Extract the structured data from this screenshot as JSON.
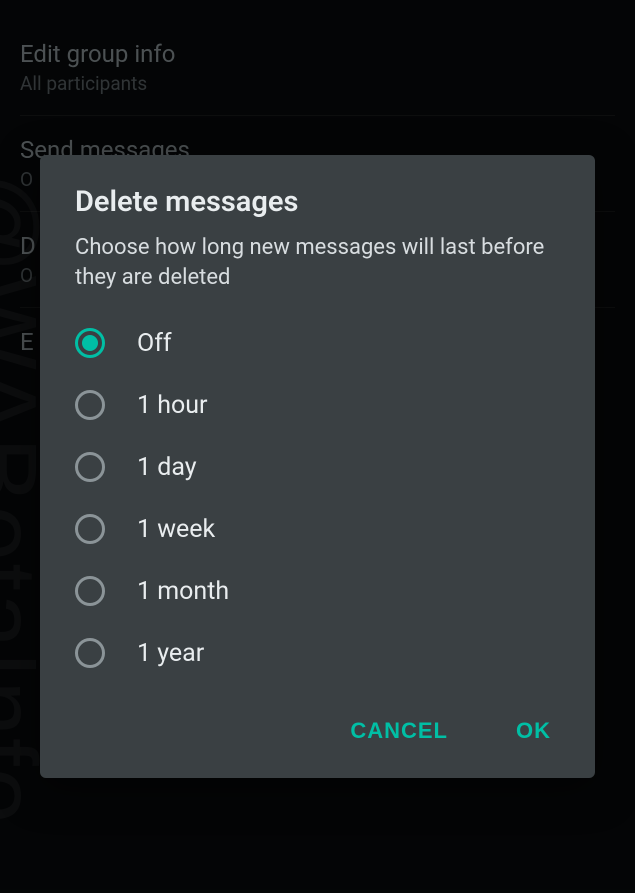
{
  "background": {
    "items": [
      {
        "title": "Edit group info",
        "subtitle": "All participants"
      },
      {
        "title": "Send messages",
        "subtitle": "O"
      },
      {
        "title": "D",
        "subtitle": "O"
      },
      {
        "title": "E",
        "subtitle": ""
      }
    ]
  },
  "dialog": {
    "title": "Delete messages",
    "subtitle": "Choose how long new messages will last before they are deleted",
    "options": [
      {
        "label": "Off",
        "selected": true
      },
      {
        "label": "1 hour",
        "selected": false
      },
      {
        "label": "1 day",
        "selected": false
      },
      {
        "label": "1 week",
        "selected": false
      },
      {
        "label": "1 month",
        "selected": false
      },
      {
        "label": "1 year",
        "selected": false
      }
    ],
    "cancel": "CANCEL",
    "ok": "OK"
  },
  "watermark": "@WABetaInfo"
}
